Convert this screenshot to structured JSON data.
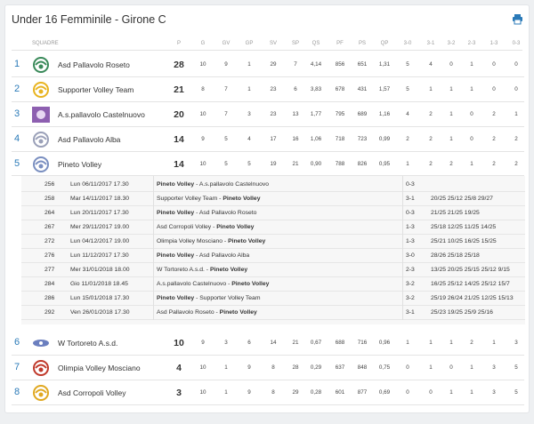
{
  "title": "Under 16 Femminile - Girone C",
  "print_icon": "print-icon",
  "accent": "#2a7ab8",
  "columns": [
    "SQUADRE",
    "P",
    "G",
    "GV",
    "GP",
    "SV",
    "SP",
    "QS",
    "PF",
    "PS",
    "QP",
    "3-0",
    "3-1",
    "3-2",
    "2-3",
    "1-3",
    "0-3"
  ],
  "teams": [
    {
      "pos": "1",
      "name": "Asd Pallavolo Roseto",
      "p": "28",
      "stats": [
        "10",
        "9",
        "1",
        "29",
        "7",
        "4,14",
        "856",
        "651",
        "1,31",
        "5",
        "4",
        "0",
        "1",
        "0",
        "0"
      ]
    },
    {
      "pos": "2",
      "name": "Supporter Volley Team",
      "p": "21",
      "stats": [
        "8",
        "7",
        "1",
        "23",
        "6",
        "3,83",
        "678",
        "431",
        "1,57",
        "5",
        "1",
        "1",
        "1",
        "0",
        "0"
      ]
    },
    {
      "pos": "3",
      "name": "A.s.pallavolo Castelnuovo",
      "p": "20",
      "stats": [
        "10",
        "7",
        "3",
        "23",
        "13",
        "1,77",
        "795",
        "689",
        "1,16",
        "4",
        "2",
        "1",
        "0",
        "2",
        "1"
      ]
    },
    {
      "pos": "4",
      "name": "Asd Pallavolo Alba",
      "p": "14",
      "stats": [
        "9",
        "5",
        "4",
        "17",
        "16",
        "1,06",
        "718",
        "723",
        "0,99",
        "2",
        "2",
        "1",
        "0",
        "2",
        "2"
      ]
    },
    {
      "pos": "5",
      "name": "Pineto Volley",
      "p": "14",
      "stats": [
        "10",
        "5",
        "5",
        "19",
        "21",
        "0,90",
        "788",
        "826",
        "0,95",
        "1",
        "2",
        "2",
        "1",
        "2",
        "2"
      ]
    },
    {
      "pos": "6",
      "name": "W Tortoreto A.s.d.",
      "p": "10",
      "stats": [
        "9",
        "3",
        "6",
        "14",
        "21",
        "0,67",
        "688",
        "716",
        "0,96",
        "1",
        "1",
        "1",
        "2",
        "1",
        "3"
      ]
    },
    {
      "pos": "7",
      "name": "Olimpia Volley Mosciano",
      "p": "4",
      "stats": [
        "10",
        "1",
        "9",
        "8",
        "28",
        "0,29",
        "637",
        "848",
        "0,75",
        "0",
        "1",
        "0",
        "1",
        "3",
        "5"
      ]
    },
    {
      "pos": "8",
      "name": "Asd Corropoli Volley",
      "p": "3",
      "stats": [
        "10",
        "1",
        "9",
        "8",
        "29",
        "0,28",
        "601",
        "877",
        "0,69",
        "0",
        "0",
        "1",
        "1",
        "3",
        "5"
      ]
    }
  ],
  "matches": [
    {
      "id": "256",
      "date": "Lun 06/11/2017 17.30",
      "home": "Pineto Volley",
      "away": "A.s.pallavolo Castelnuovo",
      "bold": "home",
      "result": "0-3",
      "sets": ""
    },
    {
      "id": "258",
      "date": "Mar 14/11/2017 18.30",
      "home": "Supporter Volley Team",
      "away": "Pineto Volley",
      "bold": "away",
      "result": "3-1",
      "sets": "20/25 25/12 25/8 29/27"
    },
    {
      "id": "264",
      "date": "Lun 20/11/2017 17.30",
      "home": "Pineto Volley",
      "away": "Asd Pallavolo Roseto",
      "bold": "home",
      "result": "0-3",
      "sets": "21/25 21/25 19/25"
    },
    {
      "id": "267",
      "date": "Mer 29/11/2017 19.00",
      "home": "Asd Corropoli Volley",
      "away": "Pineto Volley",
      "bold": "away",
      "result": "1-3",
      "sets": "25/18 12/25 11/25 14/25"
    },
    {
      "id": "272",
      "date": "Lun 04/12/2017 19.00",
      "home": "Olimpia Volley Mosciano",
      "away": "Pineto Volley",
      "bold": "away",
      "result": "1-3",
      "sets": "25/21 10/25 16/25 15/25"
    },
    {
      "id": "276",
      "date": "Lun 11/12/2017 17.30",
      "home": "Pineto Volley",
      "away": "Asd Pallavolo Alba",
      "bold": "home",
      "result": "3-0",
      "sets": "28/26 25/18 25/18"
    },
    {
      "id": "277",
      "date": "Mer 31/01/2018 18.00",
      "home": "W Tortoreto A.s.d.",
      "away": "Pineto Volley",
      "bold": "away",
      "result": "2-3",
      "sets": "13/25 20/25 25/15 25/12 9/15"
    },
    {
      "id": "284",
      "date": "Gio 11/01/2018 18.45",
      "home": "A.s.pallavolo Castelnuovo",
      "away": "Pineto Volley",
      "bold": "away",
      "result": "3-2",
      "sets": "16/25 25/12 14/25 25/12 15/7"
    },
    {
      "id": "286",
      "date": "Lun 15/01/2018 17.30",
      "home": "Pineto Volley",
      "away": "Supporter Volley Team",
      "bold": "home",
      "result": "3-2",
      "sets": "25/19 26/24 21/25 12/25 15/13"
    },
    {
      "id": "292",
      "date": "Ven 26/01/2018 17.30",
      "home": "Asd Pallavolo Roseto",
      "away": "Pineto Volley",
      "bold": "away",
      "result": "3-1",
      "sets": "25/23 19/25 25/9 25/16"
    }
  ]
}
